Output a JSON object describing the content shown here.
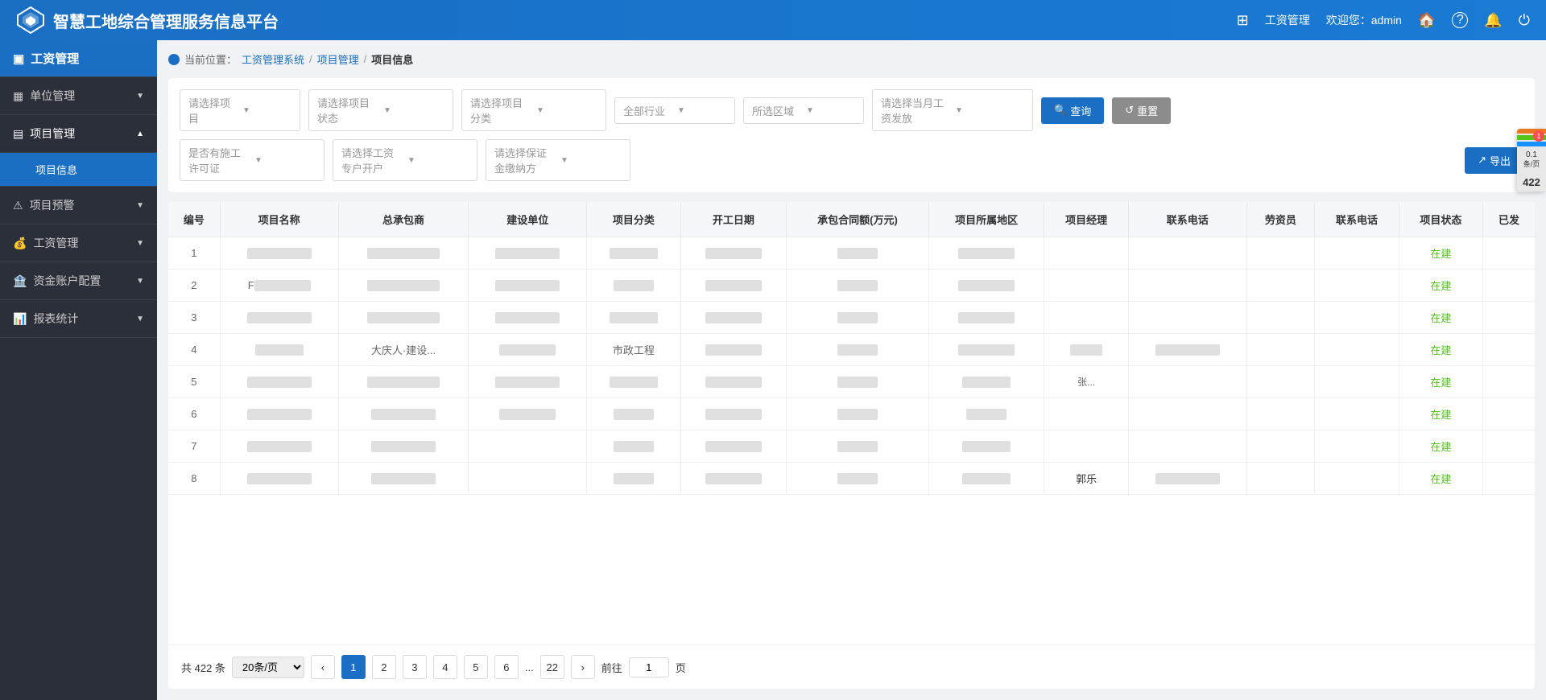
{
  "header": {
    "logo_text": "智慧工地综合管理服务信息平台",
    "grid_icon": "⊞",
    "wage_mgmt": "工资管理",
    "welcome": "欢迎您：admin",
    "home_icon": "🏠",
    "help_icon": "?",
    "bell_icon": "🔔",
    "power_icon": "⏻"
  },
  "sidebar": {
    "current_label": "工资管理",
    "items": [
      {
        "id": "unit-mgmt",
        "label": "单位管理",
        "icon": "▦",
        "has_arrow": true,
        "expanded": false
      },
      {
        "id": "project-mgmt",
        "label": "项目管理",
        "icon": "▤",
        "has_arrow": true,
        "expanded": true
      },
      {
        "id": "project-early-warning",
        "label": "项目预警",
        "icon": "⚠",
        "has_arrow": true,
        "expanded": false
      },
      {
        "id": "wage-mgmt",
        "label": "工资管理",
        "icon": "💰",
        "has_arrow": true,
        "expanded": false
      },
      {
        "id": "account-config",
        "label": "资金账户配置",
        "icon": "🏦",
        "has_arrow": true,
        "expanded": false
      },
      {
        "id": "report-stats",
        "label": "报表统计",
        "icon": "📊",
        "has_arrow": true,
        "expanded": false
      }
    ],
    "sub_items": [
      {
        "id": "project-info",
        "label": "项目信息",
        "active": true
      }
    ]
  },
  "breadcrumb": {
    "prefix": "当前位置：",
    "path": [
      "工资管理系统",
      "项目管理",
      "项目信息"
    ]
  },
  "filters": {
    "row1": [
      {
        "id": "select-project",
        "placeholder": "请选择项目"
      },
      {
        "id": "select-status",
        "placeholder": "请选择项目状态"
      },
      {
        "id": "select-category",
        "placeholder": "请选择项目分类"
      },
      {
        "id": "select-industry",
        "placeholder": "全部行业"
      },
      {
        "id": "select-area",
        "placeholder": "所选区域"
      },
      {
        "id": "select-salary",
        "placeholder": "请选择当月工资发放"
      }
    ],
    "row2": [
      {
        "id": "select-permit",
        "placeholder": "是否有施工许可证"
      },
      {
        "id": "select-account",
        "placeholder": "请选择工资专户开户"
      },
      {
        "id": "select-guarantee",
        "placeholder": "请选择保证金缴纳方"
      }
    ],
    "query_btn": "查询",
    "reset_btn": "重置",
    "export_btn": "导出"
  },
  "table": {
    "columns": [
      "编号",
      "项目名称",
      "总承包商",
      "建设单位",
      "项目分类",
      "开工日期",
      "承包合同额(万元)",
      "项目所属地区",
      "项目经理",
      "联系电话",
      "劳资员",
      "联系电话",
      "项目状态",
      "已发"
    ],
    "rows": [
      {
        "id": "1",
        "status": "在建"
      },
      {
        "id": "2",
        "status": "在建"
      },
      {
        "id": "3",
        "status": "在建"
      },
      {
        "id": "4",
        "contractor": "大庆人·建设...",
        "category": "市政工程",
        "status": "在建"
      },
      {
        "id": "5",
        "area_mgr": "张...",
        "status": "在建"
      },
      {
        "id": "6",
        "status": "在建"
      },
      {
        "id": "7",
        "status": "在建"
      },
      {
        "id": "8",
        "proj_mgr": "郭乐",
        "status": "在建"
      }
    ]
  },
  "pagination": {
    "total_text": "共 422 条",
    "page_size": "20条/页",
    "pages": [
      "1",
      "2",
      "3",
      "4",
      "5",
      "6",
      "...",
      "22"
    ],
    "current_page": "1",
    "go_text": "前往",
    "page_unit": "页"
  },
  "right_panel": {
    "badge": "1",
    "colors": [
      "#ff9900",
      "#52c41a",
      "#1890ff"
    ],
    "count": "422",
    "sub_text": "0.1\n条/页"
  }
}
